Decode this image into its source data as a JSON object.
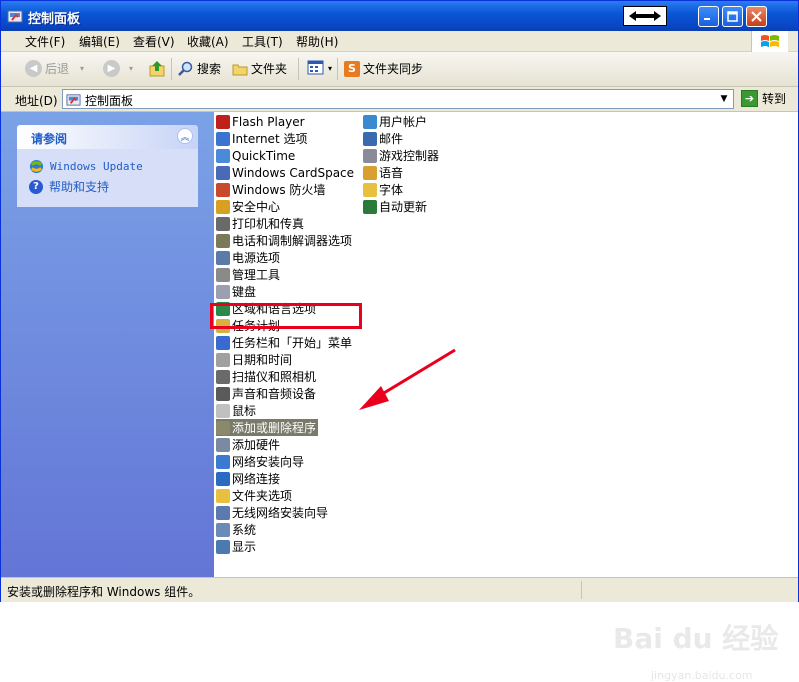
{
  "window": {
    "title": "控制面板",
    "colors": {
      "titlebar": "#0a57d6",
      "sidebar": "#6375d6",
      "highlight_border": "#e8001c"
    }
  },
  "titlebar_buttons": [
    "minimize",
    "maximize",
    "close"
  ],
  "menu": [
    "文件(F)",
    "编辑(E)",
    "查看(V)",
    "收藏(A)",
    "工具(T)",
    "帮助(H)"
  ],
  "toolbar": {
    "back": "后退",
    "search": "搜索",
    "folders": "文件夹",
    "sync": "文件夹同步"
  },
  "address": {
    "label": "地址(D)",
    "value": "控制面板",
    "go": "转到"
  },
  "sidebar": {
    "title": "请参阅",
    "links": [
      "Windows Update",
      "帮助和支持"
    ]
  },
  "items_col1": [
    {
      "label": "Flash Player",
      "icon": "flash-icon",
      "color": "#c0201a"
    },
    {
      "label": "Internet 选项",
      "icon": "internet-options-icon",
      "color": "#3a74d0"
    },
    {
      "label": "QuickTime",
      "icon": "quicktime-icon",
      "color": "#4a8ad8"
    },
    {
      "label": "Windows CardSpace",
      "icon": "cardspace-icon",
      "color": "#4a6ab8"
    },
    {
      "label": "Windows 防火墙",
      "icon": "firewall-icon",
      "color": "#c84a2a"
    },
    {
      "label": "安全中心",
      "icon": "security-center-icon",
      "color": "#d8a020"
    },
    {
      "label": "打印机和传真",
      "icon": "printer-icon",
      "color": "#6a6a6a"
    },
    {
      "label": "电话和调制解调器选项",
      "icon": "phone-modem-icon",
      "color": "#7a7a5a"
    },
    {
      "label": "电源选项",
      "icon": "power-options-icon",
      "color": "#5a7aa8"
    },
    {
      "label": "管理工具",
      "icon": "admin-tools-icon",
      "color": "#8a8a8a"
    },
    {
      "label": "键盘",
      "icon": "keyboard-icon",
      "color": "#9aa0b0"
    },
    {
      "label": "区域和语言选项",
      "icon": "region-language-icon",
      "color": "#2a8a4a"
    },
    {
      "label": "任务计划",
      "icon": "scheduled-tasks-icon",
      "color": "#d8b040"
    },
    {
      "label": "任务栏和「开始」菜单",
      "icon": "taskbar-icon",
      "color": "#3a6ad0"
    },
    {
      "label": "日期和时间",
      "icon": "date-time-icon",
      "color": "#a0a0a0"
    },
    {
      "label": "扫描仪和照相机",
      "icon": "scanner-camera-icon",
      "color": "#6a6a6a"
    },
    {
      "label": "声音和音频设备",
      "icon": "sound-icon",
      "color": "#5a5a5a"
    },
    {
      "label": "鼠标",
      "icon": "mouse-icon",
      "color": "#c0c0c0"
    },
    {
      "label": "添加或删除程序",
      "icon": "add-remove-programs-icon",
      "color": "#8a8a6a",
      "selected": true
    },
    {
      "label": "添加硬件",
      "icon": "add-hardware-icon",
      "color": "#7a8aa0"
    },
    {
      "label": "网络安装向导",
      "icon": "network-setup-icon",
      "color": "#3a7ad0"
    },
    {
      "label": "网络连接",
      "icon": "network-connections-icon",
      "color": "#2a6ac0"
    },
    {
      "label": "文件夹选项",
      "icon": "folder-options-icon",
      "color": "#e8c040"
    },
    {
      "label": "无线网络安装向导",
      "icon": "wireless-setup-icon",
      "color": "#5a7ab0"
    },
    {
      "label": "系统",
      "icon": "system-icon",
      "color": "#6a8ab8"
    },
    {
      "label": "显示",
      "icon": "display-icon",
      "color": "#4a7ab0"
    }
  ],
  "items_col2": [
    {
      "label": "用户帐户",
      "icon": "user-accounts-icon",
      "color": "#3a8ad0"
    },
    {
      "label": "邮件",
      "icon": "mail-icon",
      "color": "#3a6ab0"
    },
    {
      "label": "游戏控制器",
      "icon": "game-controller-icon",
      "color": "#8a8a9a"
    },
    {
      "label": "语音",
      "icon": "speech-icon",
      "color": "#d8a030"
    },
    {
      "label": "字体",
      "icon": "fonts-icon",
      "color": "#e8c040"
    },
    {
      "label": "自动更新",
      "icon": "automatic-updates-icon",
      "color": "#2a7a3a"
    }
  ],
  "status": {
    "text": "安装或删除程序和 Windows 组件。"
  },
  "watermark": {
    "text": "Bai du 经验",
    "sub": "jingyan.baidu.com"
  }
}
